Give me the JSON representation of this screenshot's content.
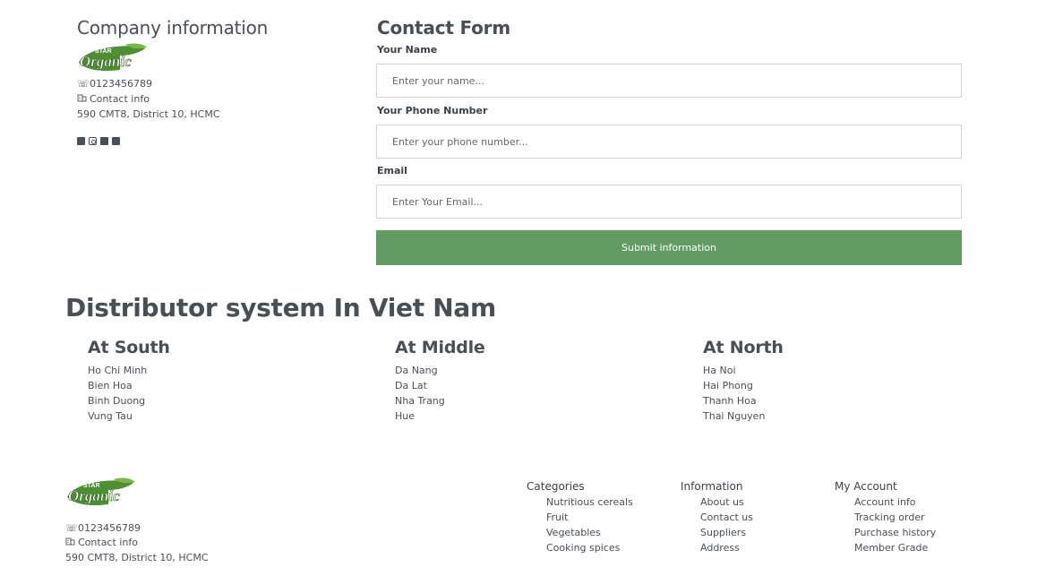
{
  "company": {
    "title": "Company information",
    "phone": "0123456789",
    "contact": "Contact info",
    "address": "590 CMT8, District 10, HCMC",
    "socials": [
      "facebook-icon",
      "instagram-icon",
      "twitter-icon",
      "linkedin-icon"
    ]
  },
  "logo": {
    "top_text": "STAR",
    "main_text": "Organic"
  },
  "form": {
    "title": "Contact Form",
    "name_label": "Your Name",
    "name_placeholder": "Enter your name...",
    "phone_label": "Your Phone Number",
    "phone_placeholder": "Enter your phone number...",
    "email_label": "Email",
    "email_placeholder": "Enter Your Email...",
    "submit_label": "Submit information"
  },
  "distributor": {
    "title": "Distributor system In Viet Nam",
    "south": {
      "title": "At South",
      "cities": [
        "Ho Chi Minh",
        "Bien Hoa",
        "Binh Duong",
        "Vung Tau"
      ]
    },
    "middle": {
      "title": "At Middle",
      "cities": [
        "Da Nang",
        "Da Lat",
        "Nha Trang",
        "Hue"
      ]
    },
    "north": {
      "title": "At North",
      "cities": [
        "Ha Noi",
        "Hai Phong",
        "Thanh Hoa",
        "Thai Nguyen"
      ]
    }
  },
  "footer": {
    "phone": "0123456789",
    "contact": "Contact info",
    "address": "590 CMT8, District 10, HCMC",
    "categories": {
      "title": "Categories",
      "items": [
        "Nutritious cereals",
        "Fruit",
        "Vegetables",
        "Cooking spices"
      ]
    },
    "information": {
      "title": "Information",
      "items": [
        "About us",
        "Contact us",
        "Suppliers",
        "Address"
      ]
    },
    "account": {
      "title": "My Account",
      "items": [
        "Account info",
        "Tracking order",
        "Purchase history",
        "Member Grade"
      ]
    }
  },
  "colors": {
    "accent": "#629c64",
    "text": "#4a4f55",
    "logo_green": "#3f7d2a"
  },
  "icons": {
    "phone": "☏",
    "contact": "building-icon"
  }
}
